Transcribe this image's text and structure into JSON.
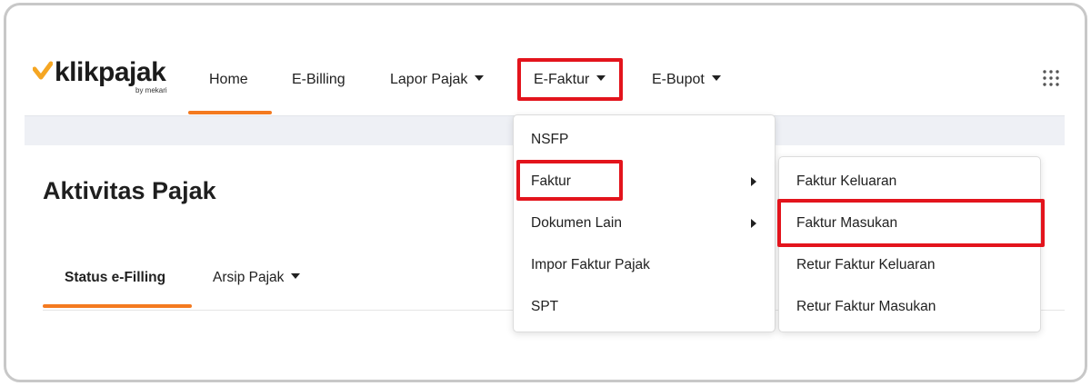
{
  "brand": {
    "name": "klikpajak",
    "byline": "by mekari",
    "accent": "#f47a20"
  },
  "nav": {
    "items": [
      {
        "label": "Home"
      },
      {
        "label": "E-Billing"
      },
      {
        "label": "Lapor Pajak"
      },
      {
        "label": "E-Faktur"
      },
      {
        "label": "E-Bupot"
      }
    ],
    "apps_icon": "grid-apps-icon"
  },
  "page": {
    "title": "Aktivitas Pajak",
    "tabs": [
      {
        "label": "Status e-Filling"
      },
      {
        "label": "Arsip Pajak"
      }
    ]
  },
  "efaktur_menu": {
    "items": [
      {
        "label": "NSFP"
      },
      {
        "label": "Faktur"
      },
      {
        "label": "Dokumen Lain"
      },
      {
        "label": "Impor Faktur Pajak"
      },
      {
        "label": "SPT"
      }
    ]
  },
  "faktur_submenu": {
    "items": [
      {
        "label": "Faktur Keluaran"
      },
      {
        "label": "Faktur Masukan"
      },
      {
        "label": "Retur Faktur Keluaran"
      },
      {
        "label": "Retur Faktur Masukan"
      }
    ]
  },
  "highlight_color": "#e3141c"
}
